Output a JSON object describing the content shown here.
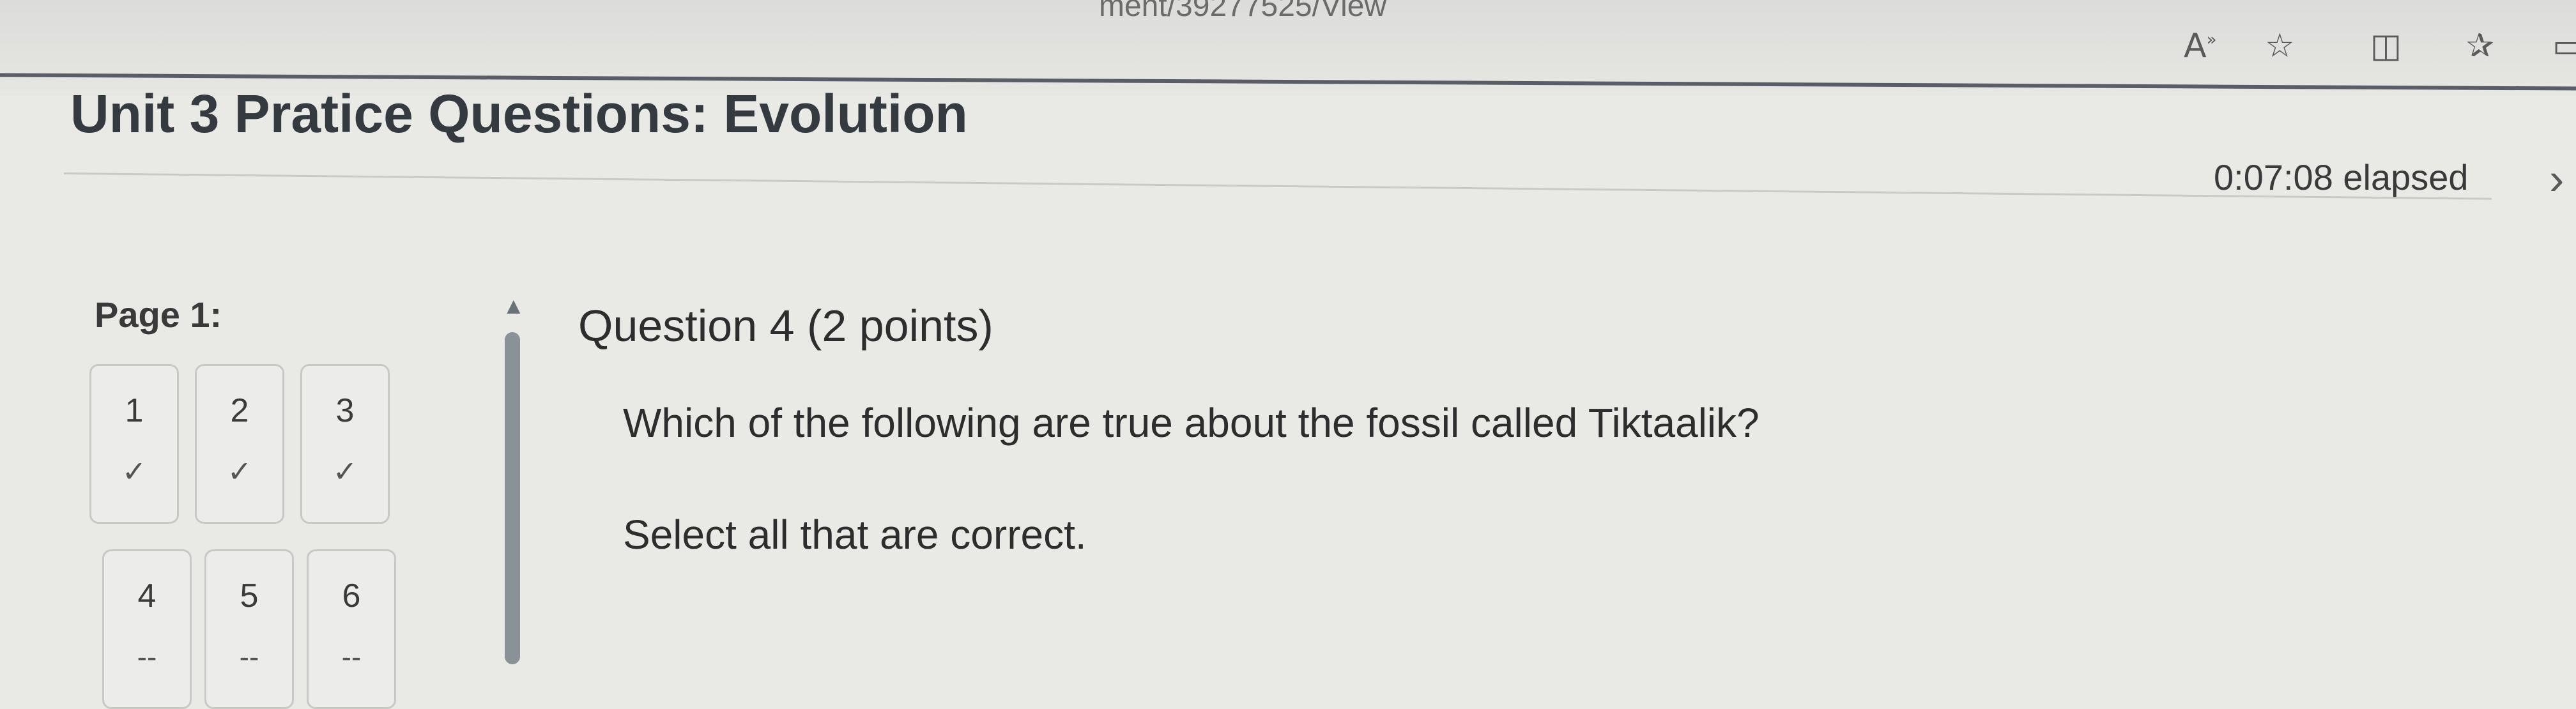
{
  "browser": {
    "url_fragment": "ment/39277525/View",
    "icons": [
      "read-aloud-icon",
      "favorite-star-icon",
      "split-screen-icon",
      "favorites-list-icon"
    ]
  },
  "quiz": {
    "title": "Unit 3 Pratice Questions: Evolution",
    "elapsed": "0:07:08 elapsed"
  },
  "navigator": {
    "page_label": "Page 1:",
    "questions": [
      {
        "number": "1",
        "status": "✓"
      },
      {
        "number": "2",
        "status": "✓"
      },
      {
        "number": "3",
        "status": "✓"
      },
      {
        "number": "4",
        "status": "--"
      },
      {
        "number": "5",
        "status": "--"
      },
      {
        "number": "6",
        "status": "--"
      }
    ]
  },
  "question": {
    "label": "Question 4",
    "points": "(2 points)",
    "text": "Which of the following are true about the fossil called Tiktaalik?",
    "instruction": "Select all that are correct."
  }
}
